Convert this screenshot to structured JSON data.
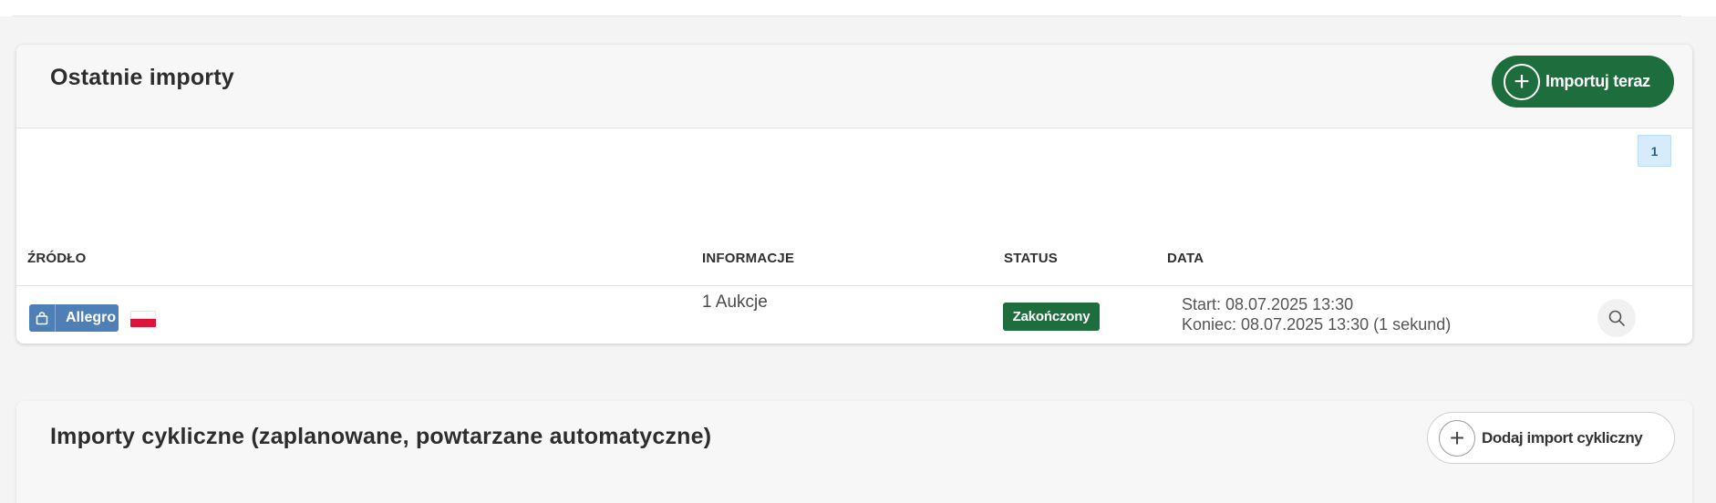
{
  "recent_imports": {
    "title": "Ostatnie importy",
    "import_now_label": "Importuj teraz",
    "pagination": {
      "current_page": "1"
    },
    "columns": {
      "source": "ŹRÓDŁO",
      "info": "INFORMACJE",
      "status": "STATUS",
      "date": "DATA"
    },
    "rows": [
      {
        "source": {
          "name": "Allegro",
          "icon": "shopping-bag-icon",
          "flag": "poland-flag-icon"
        },
        "info": "1 Aukcje",
        "status": "Zakończony",
        "start": "Start: 08.07.2025 13:30",
        "end": "Koniec: 08.07.2025 13:30 (1 sekund)"
      }
    ]
  },
  "cyclic_imports": {
    "title": "Importy cykliczne (zaplanowane, powtarzane automatyczne)",
    "add_label": "Dodaj import cykliczny"
  },
  "colors": {
    "primary_green": "#1d6e3c",
    "allegro_blue": "#4f7fb7",
    "pager_bg": "#d6ecfb"
  }
}
